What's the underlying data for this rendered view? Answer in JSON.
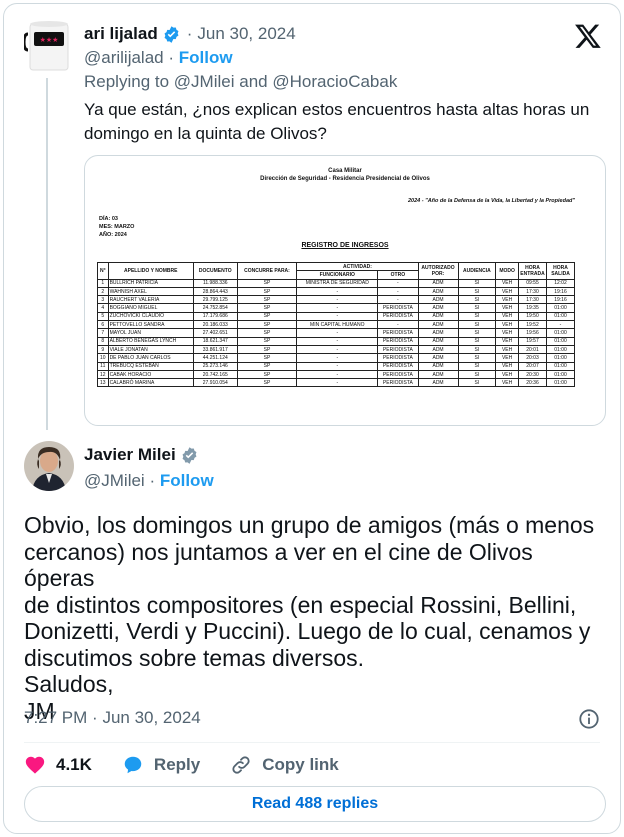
{
  "parent_tweet": {
    "author_name": "ari lijalad",
    "date": "Jun 30, 2024",
    "handle": "@arilijalad",
    "follow_label": "Follow",
    "replying_prefix": "Replying to",
    "replying_to_1": "@JMilei",
    "replying_and": "and",
    "replying_to_2": "@HoracioCabak",
    "text": "Ya que están, ¿nos explican estos encuentros hasta altas horas un domingo en la quinta de Olivos?",
    "image": {
      "header_1": "Casa Militar",
      "header_2": "Dirección de Seguridad - Residencia Presidencial de Olivos",
      "motto": "2024 - \"Año de la Defensa de la Vida, la Libertad y la Propiedad\"",
      "dia": "DÍA: 03",
      "mes": "MES: MARZO",
      "anio": "AÑO: 2024",
      "registro_title": "REGISTRO DE INGRESOS",
      "columns": {
        "n": "N°",
        "apellido": "APELLIDO Y NOMBRE",
        "documento": "DOCUMENTO",
        "concurre": "CONCURRE PARA:",
        "actividad": "ACTIVIDAD:",
        "funcionario": "FUNCIONARIO",
        "otro": "OTRO",
        "autorizado": "AUTORIZADO POR:",
        "audiencia": "AUDIENCIA",
        "modo": "MODO",
        "entrada": "HORA ENTRADA",
        "salida": "HORA SALIDA"
      },
      "rows": [
        [
          "1",
          "BULLRICH PATRICIA",
          "11.988.336",
          "SP",
          "MINISTRA DE SEGURIDAD",
          "-",
          "ADM",
          "SI",
          "VEH",
          "09:55",
          "12:02"
        ],
        [
          "2",
          "WAHNISH AXEL",
          "28.864.443",
          "SP",
          "-",
          "-",
          "ADM",
          "SI",
          "VEH",
          "17:30",
          "19:16"
        ],
        [
          "3",
          "RAUCHERT VALERIA",
          "29.799.125",
          "SP",
          "-",
          "-",
          "ADM",
          "SI",
          "VEH",
          "17:30",
          "19:16"
        ],
        [
          "4",
          "BOGGIANO MIGUEL",
          "24.752.854",
          "SP",
          "-",
          "PERIODISTA",
          "ADM",
          "SI",
          "VEH",
          "19:35",
          "01:00"
        ],
        [
          "5",
          "ZUCHOVICKI CLAUDIO",
          "17.179.686",
          "SP",
          "-",
          "PERIODISTA",
          "ADM",
          "SI",
          "VEH",
          "19:50",
          "01:00"
        ],
        [
          "6",
          "PETTOVELLO SANDRA",
          "20.186.033",
          "SP",
          "MIN CAPITAL HUMANO",
          "-",
          "ADM",
          "SI",
          "VEH",
          "19:52",
          "-"
        ],
        [
          "7",
          "MAYOL JUAN",
          "27.402.651",
          "SP",
          "-",
          "PERIODISTA",
          "ADM",
          "SI",
          "VEH",
          "19:56",
          "01:00"
        ],
        [
          "8",
          "ALBERTO BENEGAS LYNCH",
          "18.621.347",
          "SP",
          "-",
          "PERIODISTA",
          "ADM",
          "SI",
          "VEH",
          "19:57",
          "01:00"
        ],
        [
          "9",
          "VIALE JONATAN",
          "33.861.917",
          "SP",
          "-",
          "PERIODISTA",
          "ADM",
          "SI",
          "VEH",
          "20:01",
          "01:00"
        ],
        [
          "10",
          "DE PABLO JUAN CARLOS",
          "44.251.124",
          "SP",
          "-",
          "PERIODISTA",
          "ADM",
          "SI",
          "VEH",
          "20:03",
          "01:00"
        ],
        [
          "11",
          "TREBUCQ ESTEBAN",
          "25.273.146",
          "SP",
          "-",
          "PERIODISTA",
          "ADM",
          "SI",
          "VEH",
          "20:07",
          "01:00"
        ],
        [
          "12",
          "CABAK HORACIO",
          "20.742.165",
          "SP",
          "-",
          "PERIODISTA",
          "ADM",
          "SI",
          "VEH",
          "20:30",
          "01:00"
        ],
        [
          "13",
          "CALABRÓ MARINA",
          "27.910.054",
          "SP",
          "-",
          "PERIODISTA",
          "ADM",
          "SI",
          "VEH",
          "20:36",
          "01:00"
        ]
      ]
    }
  },
  "main_tweet": {
    "author_name": "Javier Milei",
    "handle": "@JMilei",
    "follow_label": "Follow",
    "text_lines": [
      "Obvio, los domingos un grupo de amigos (más o menos",
      "cercanos) nos juntamos a ver en el cine de Olivos óperas",
      "de distintos compositores (en especial Rossini, Bellini,",
      "Donizetti, Verdi y Puccini). Luego de lo cual, cenamos y",
      "discutimos sobre temas diversos.",
      "Saludos,",
      "JM"
    ],
    "time": "7:27 PM",
    "date": "Jun 30, 2024",
    "likes": "4.1K",
    "reply_label": "Reply",
    "copy_link_label": "Copy link",
    "read_replies_label": "Read 488 replies"
  },
  "colors": {
    "accent": "#1d9bf0",
    "link_button": "#006fd6",
    "secondary_text": "#536471",
    "like": "#f91880",
    "border": "#cfd9de"
  },
  "icons": {
    "brand": "x-logo-icon",
    "verified": "verified-badge-icon",
    "info": "info-icon",
    "like": "heart-icon",
    "reply": "speech-bubble-icon",
    "copy": "link-icon"
  }
}
